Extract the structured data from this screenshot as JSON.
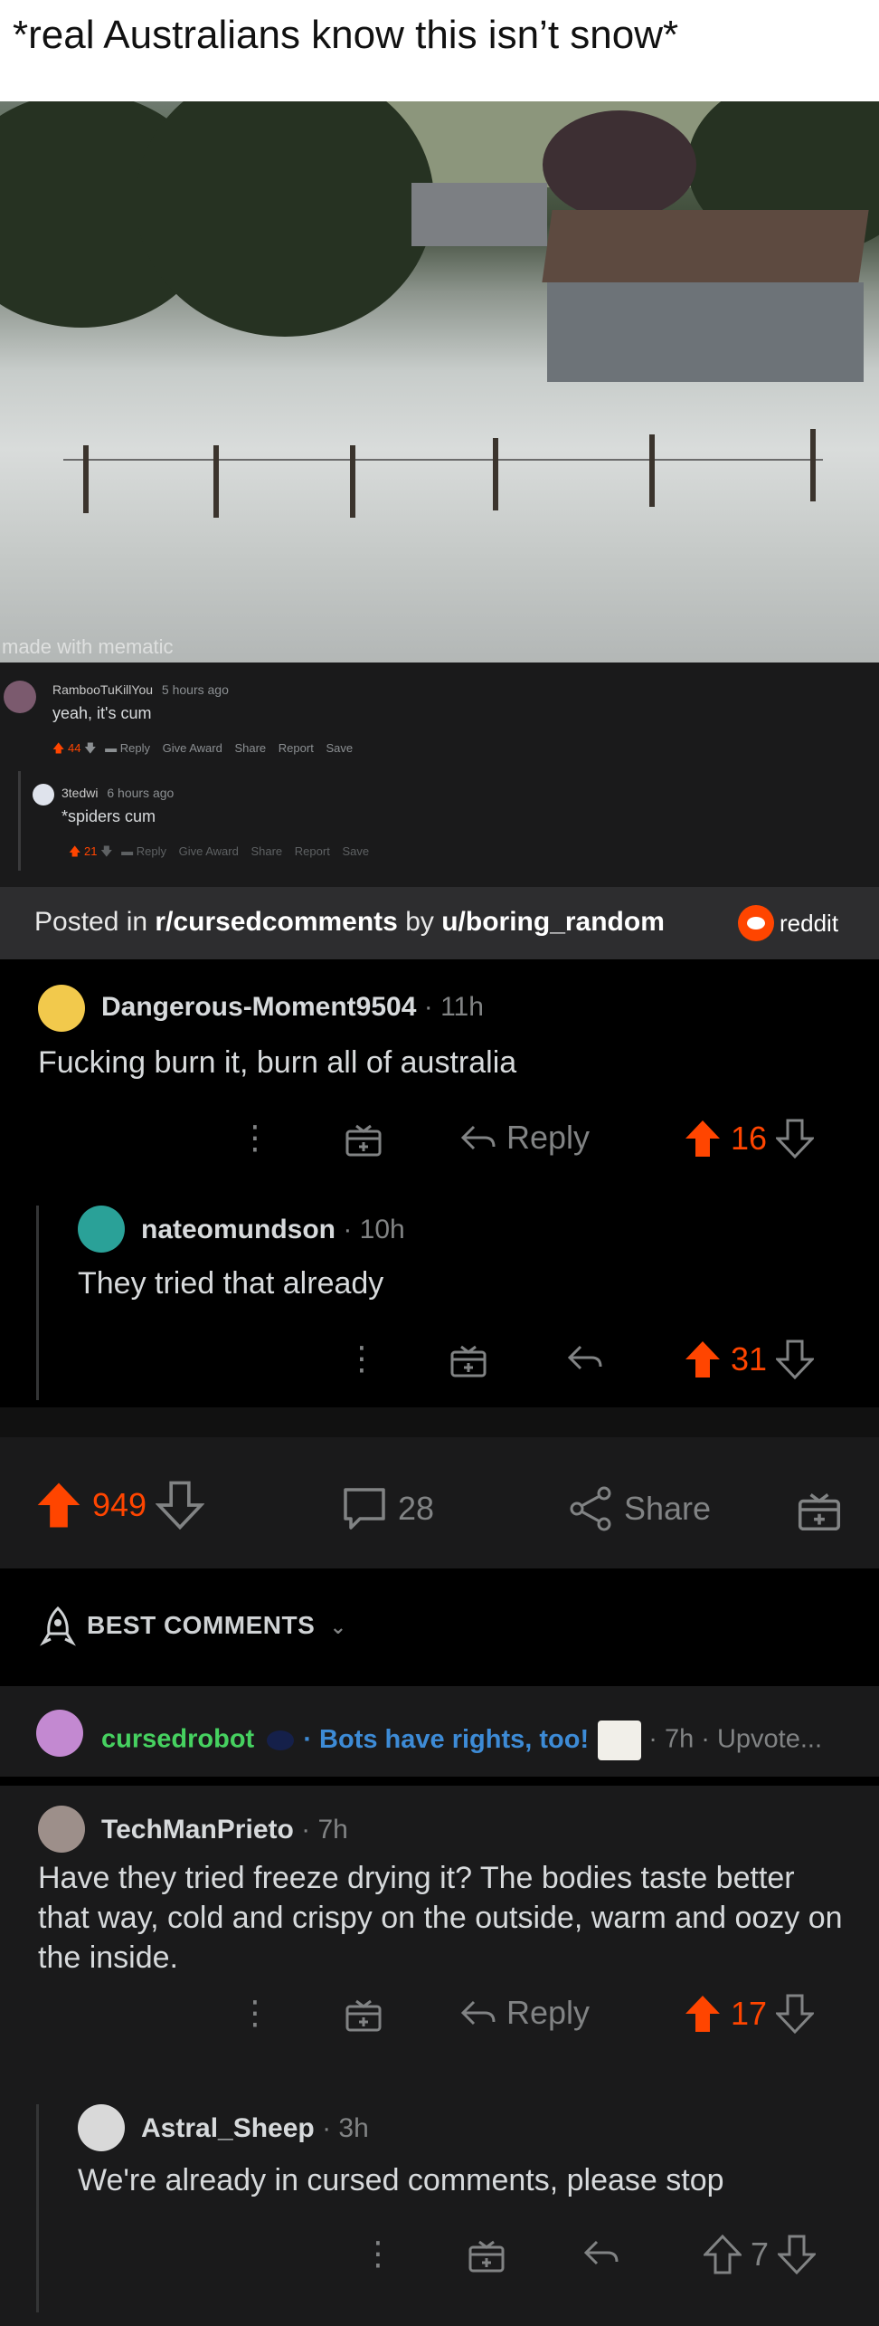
{
  "meme": {
    "caption": "*real Australians know this isn’t snow*",
    "watermark": "made with mematic"
  },
  "inner_screenshot": {
    "comment1": {
      "user": "RambooTuKillYou",
      "time": "5 hours ago",
      "text": "yeah, it's cum",
      "score": "44",
      "actions": [
        "Reply",
        "Give Award",
        "Share",
        "Report",
        "Save"
      ]
    },
    "comment2": {
      "user": "3tedwi",
      "time": "6 hours ago",
      "text": "*spiders cum",
      "score": "21",
      "actions": [
        "Reply",
        "Give Award",
        "Share",
        "Report",
        "Save"
      ]
    }
  },
  "posted_bar": {
    "prefix": "Posted in ",
    "subreddit": "r/cursedcomments",
    "by": " by ",
    "user": "u/boring_random",
    "brand": "reddit"
  },
  "embedded_comments": [
    {
      "user": "Dangerous-Moment9504",
      "time": " · 11h",
      "text": "Fucking burn it, burn all of australia",
      "reply_label": "Reply",
      "score": "16"
    },
    {
      "user": "nateomundson",
      "time": " · 10h",
      "text": "They tried that already",
      "score": "31"
    }
  ],
  "post_actions": {
    "score": "949",
    "comments": "28",
    "share_label": "Share"
  },
  "sort": {
    "label": "BEST COMMENTS"
  },
  "bot_comment": {
    "user": "cursedrobot",
    "flair": "Bots have rights, too!",
    "meta": " · 7h · Upvote..."
  },
  "comments": [
    {
      "user": "TechManPrieto",
      "time": " · 7h",
      "text": "Have they tried freeze drying it? The bodies taste better that way, cold and crispy on the outside, warm and oozy on the inside.",
      "reply_label": "Reply",
      "score": "17"
    },
    {
      "user": "Astral_Sheep",
      "time": " · 3h",
      "text": "We're already in cursed comments, please stop",
      "score": "7"
    }
  ],
  "colors": {
    "upvote": "#ff4500",
    "bot_name": "#46d160",
    "flair": "#3d8bd6"
  }
}
